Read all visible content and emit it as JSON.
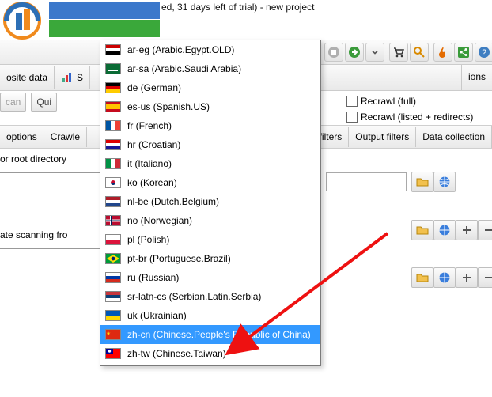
{
  "window_title_suffix": "ed, 31 days left of trial) - new project",
  "locale_expanded_suffix": "h.US)",
  "tabs_row2": {
    "left": [
      "osite data",
      "S"
    ],
    "right": [
      "ions"
    ]
  },
  "btn_can": "can",
  "btn_quick": "Qui",
  "recrawl_full": "Recrawl (full)",
  "recrawl_listed": "Recrawl (listed + redirects)",
  "tabs_row4_left": [
    "options",
    "Crawle"
  ],
  "tabs_row4_right": [
    "filters",
    "Output filters",
    "Data collection"
  ],
  "label_root": "or root directory",
  "label_scan": "ate scanning fro",
  "dropdown_items": [
    {
      "code": "ar-eg",
      "label": "ar-eg (Arabic.Egypt.OLD)",
      "flag": "eg"
    },
    {
      "code": "ar-sa",
      "label": "ar-sa (Arabic.Saudi Arabia)",
      "flag": "sa"
    },
    {
      "code": "de",
      "label": "de (German)",
      "flag": "de"
    },
    {
      "code": "es-us",
      "label": "es-us (Spanish.US)",
      "flag": "es"
    },
    {
      "code": "fr",
      "label": "fr (French)",
      "flag": "fr"
    },
    {
      "code": "hr",
      "label": "hr (Croatian)",
      "flag": "hr"
    },
    {
      "code": "it",
      "label": "it (Italiano)",
      "flag": "it"
    },
    {
      "code": "ko",
      "label": "ko (Korean)",
      "flag": "kr"
    },
    {
      "code": "nl-be",
      "label": "nl-be (Dutch.Belgium)",
      "flag": "nl"
    },
    {
      "code": "no",
      "label": "no (Norwegian)",
      "flag": "no"
    },
    {
      "code": "pl",
      "label": "pl (Polish)",
      "flag": "pl"
    },
    {
      "code": "pt-br",
      "label": "pt-br (Portuguese.Brazil)",
      "flag": "br"
    },
    {
      "code": "ru",
      "label": "ru (Russian)",
      "flag": "ru"
    },
    {
      "code": "sr-latn-cs",
      "label": "sr-latn-cs (Serbian.Latin.Serbia)",
      "flag": "rs"
    },
    {
      "code": "uk",
      "label": "uk (Ukrainian)",
      "flag": "ua"
    },
    {
      "code": "zh-cn",
      "label": "zh-cn (Chinese.People's Republic of China)",
      "flag": "cn",
      "selected": true
    },
    {
      "code": "zh-tw",
      "label": "zh-tw (Chinese.Taiwan)",
      "flag": "tw"
    }
  ],
  "icons_row4": {
    "chart": "chart-icon"
  }
}
